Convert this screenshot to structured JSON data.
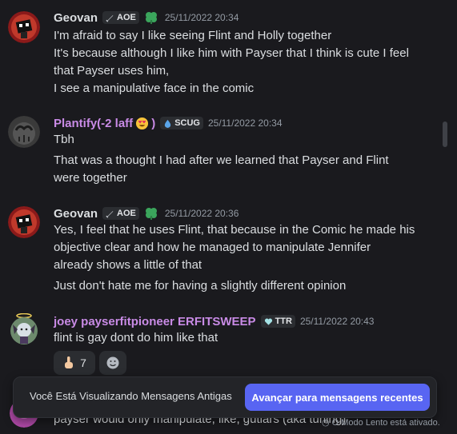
{
  "messages": [
    {
      "author": "Geovan",
      "tag": "AOE",
      "timestamp": "25/11/2022 20:34",
      "author_color": "#dbdee1",
      "lines": [
        "I'm afraid to say I like seeing Flint and Holly together",
        "It's because although I like him with Payser that I think is cute I feel",
        "that Payser uses him,",
        "I see a manipulative face in the comic"
      ]
    },
    {
      "author": "Plantify(-2 laff",
      "author_suffix": ")",
      "tag": "SCUG",
      "timestamp": "25/11/2022 20:34",
      "author_color": "#c98be6",
      "lines": [
        "Tbh",
        "That was a thought I had after we learned that Payser and Flint",
        "were together"
      ]
    },
    {
      "author": "Geovan",
      "tag": "AOE",
      "timestamp": "25/11/2022 20:36",
      "author_color": "#dbdee1",
      "lines": [
        "Yes, I feel that he uses Flint, that because in the Comic he made his",
        "objective clear and how he managed to manipulate Jennifer",
        "already shows a little of that",
        "Just don't hate me for having a slightly different opinion"
      ]
    },
    {
      "author": "joey payserfitpioneer ERFITSWEEP",
      "tag": "TTR",
      "timestamp": "25/11/2022 20:43",
      "author_color": "#c98be6",
      "lines": [
        "flint is gay dont do him like that"
      ],
      "reactions": [
        {
          "icon": "point-up-emoji",
          "count": "7"
        },
        {
          "icon": "add-reaction-icon",
          "count": ""
        }
      ]
    }
  ],
  "partial_line": "payser would only manipulate, like, gutiars (aka tuning)",
  "banner": {
    "text": "Você Está Visualizando Mensagens Antigas",
    "button": "Avançar para mensagens recentes"
  },
  "slow_mode": "O Modo Lento está ativado.",
  "colors": {
    "background": "#1a1a1e",
    "accent": "#5865f2",
    "tag_bg": "#2b2d31",
    "clover": "#3ba55c"
  }
}
